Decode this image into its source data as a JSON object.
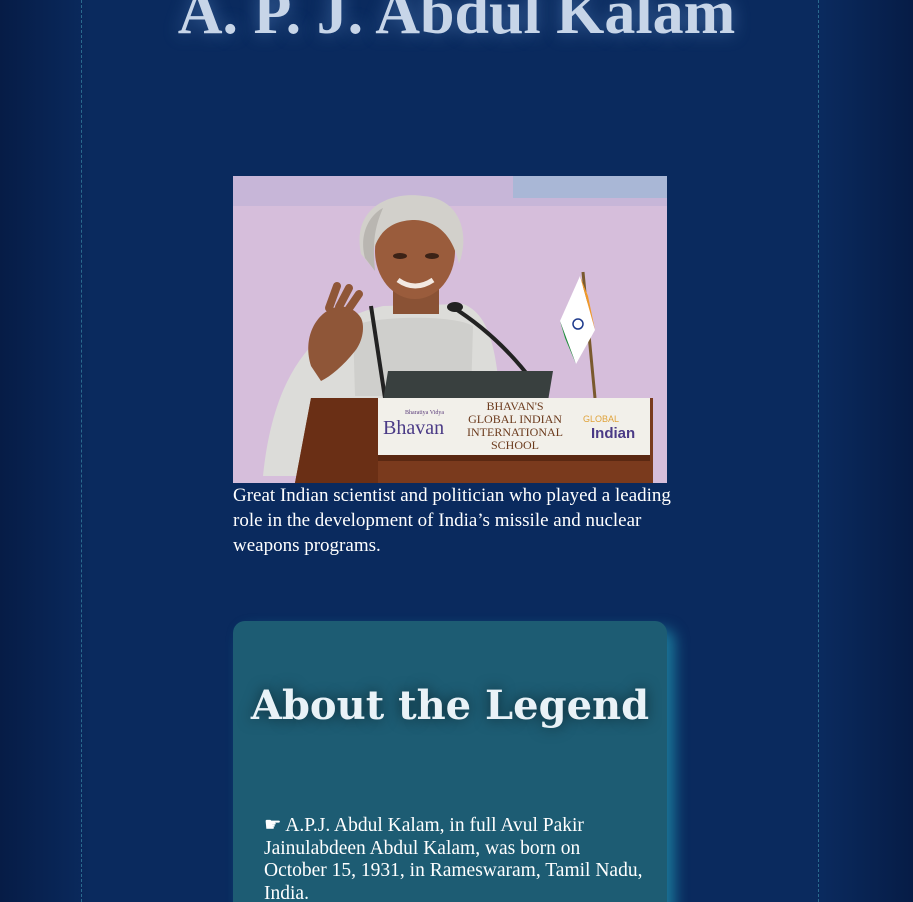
{
  "header": {
    "title": "A. P. J. Abdul Kalam"
  },
  "portrait": {
    "podium_sign": {
      "brand_small": "Bharatiya Vidya",
      "brand_large": "Bhavan",
      "line1": "BHAVAN'S",
      "line2": "GLOBAL INDIAN",
      "line3": "INTERNATIONAL",
      "line4": "SCHOOL",
      "logo_top": "GLOBAL",
      "logo_main": "Indian"
    }
  },
  "caption": "Great Indian scientist and politician who played a leading role in the development of India’s missile and nuclear weapons programs.",
  "about": {
    "heading": "About the Legend",
    "bullet_icon": "hand-pointing-icon",
    "paragraph": "☛ A.P.J. Abdul Kalam, in full Avul Pakir Jainulabdeen Abdul Kalam, was born on October 15, 1931, in Rameswaram, Tamil Nadu, India."
  },
  "colors": {
    "background": "#0a2a5e",
    "title": "#c7d5e8",
    "card": "#1d5c73",
    "card_glow": "#28b4c8"
  }
}
